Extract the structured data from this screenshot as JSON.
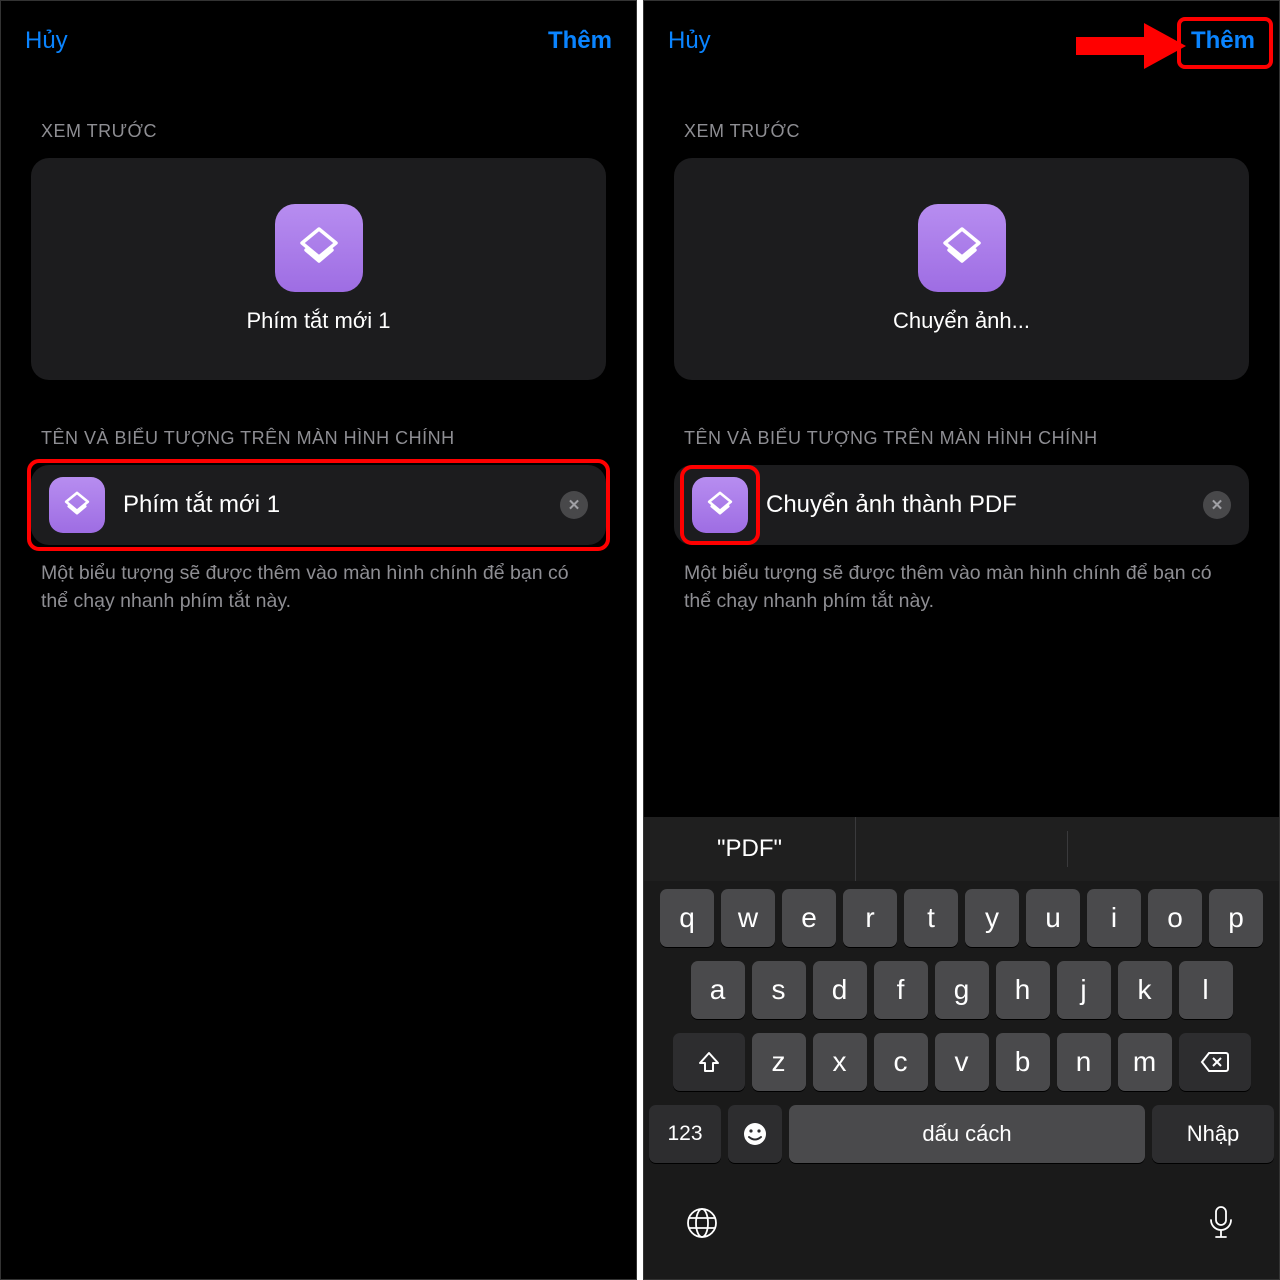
{
  "left": {
    "cancel_label": "Hủy",
    "add_label": "Thêm",
    "preview_header": "XEM TRƯỚC",
    "preview_name": "Phím tắt mới 1",
    "name_header": "TÊN VÀ BIỂU TƯỢNG TRÊN MÀN HÌNH CHÍNH",
    "name_value": "Phím tắt mới 1",
    "hint": "Một biểu tượng sẽ được thêm vào màn hình chính để bạn có thể chạy nhanh phím tắt này."
  },
  "right": {
    "cancel_label": "Hủy",
    "add_label": "Thêm",
    "preview_header": "XEM TRƯỚC",
    "preview_name": "Chuyển ảnh...",
    "name_header": "TÊN VÀ BIỂU TƯỢNG TRÊN MÀN HÌNH CHÍNH",
    "name_value": "Chuyển ảnh thành PDF",
    "hint": "Một biểu tượng sẽ được thêm vào màn hình chính để bạn có thể chạy nhanh phím tắt này."
  },
  "keyboard": {
    "prediction": "\"PDF\"",
    "row1": [
      "q",
      "w",
      "e",
      "r",
      "t",
      "y",
      "u",
      "i",
      "o",
      "p"
    ],
    "row2": [
      "a",
      "s",
      "d",
      "f",
      "g",
      "h",
      "j",
      "k",
      "l"
    ],
    "row3": [
      "z",
      "x",
      "c",
      "v",
      "b",
      "n",
      "m"
    ],
    "numbers_label": "123",
    "space_label": "dấu cách",
    "enter_label": "Nhập"
  }
}
